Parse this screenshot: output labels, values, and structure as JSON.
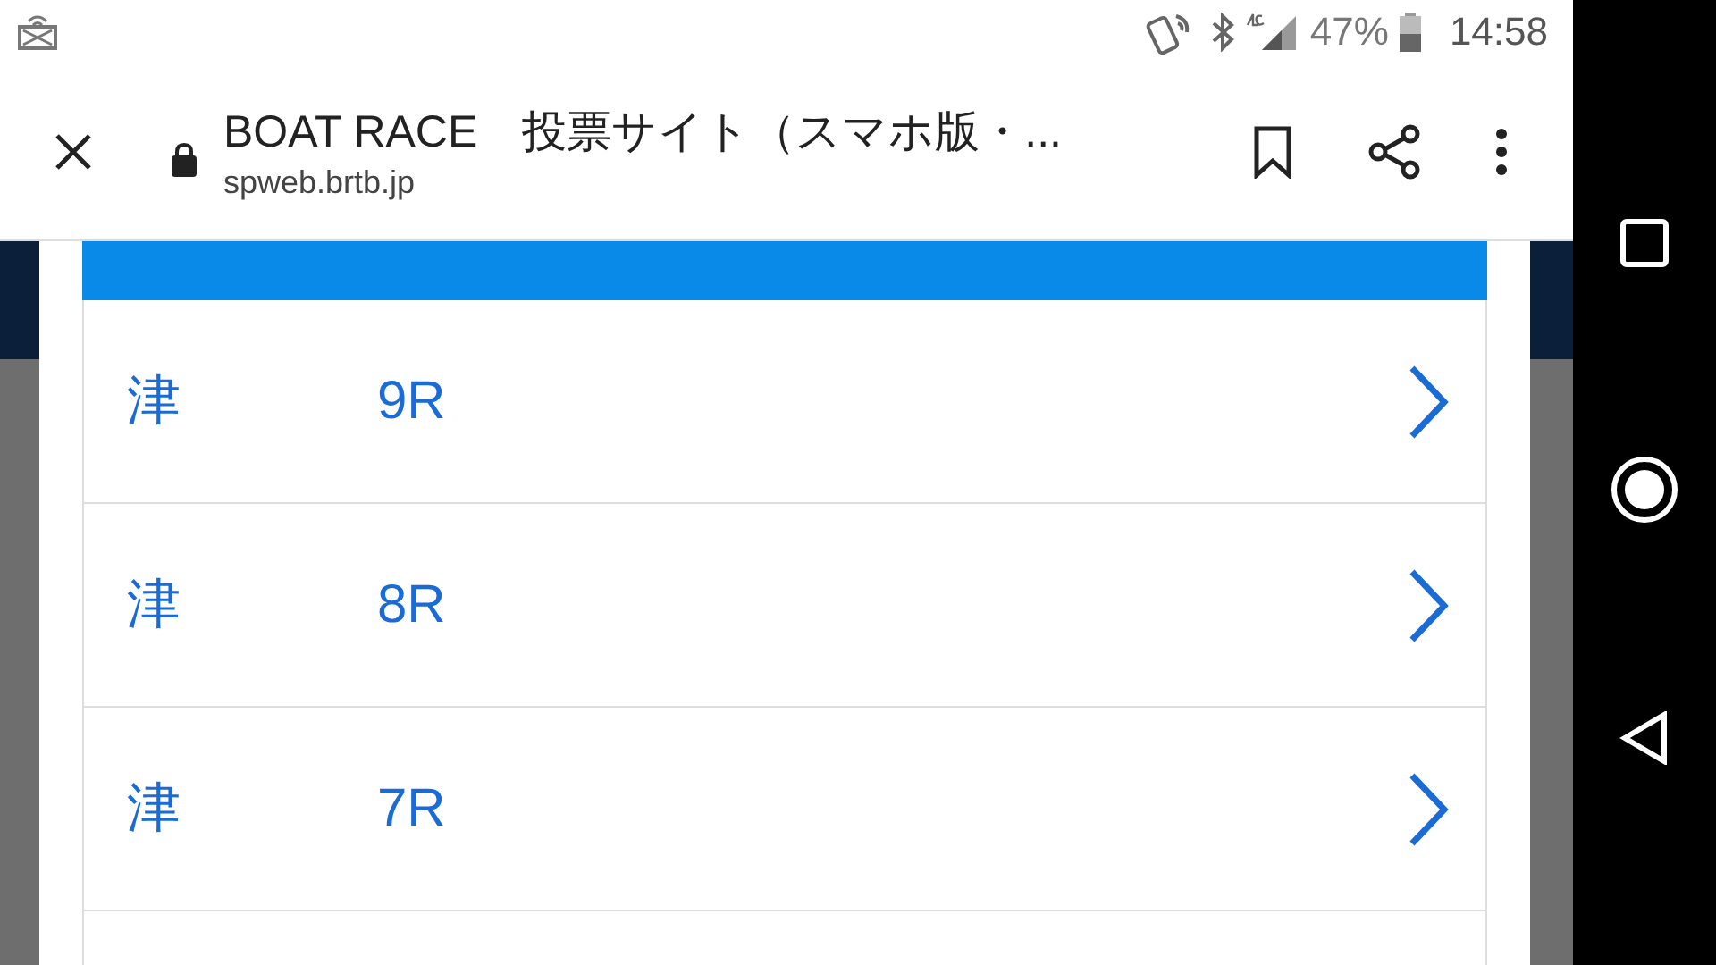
{
  "status_bar": {
    "battery": "47%",
    "time": "14:58"
  },
  "browser_toolbar": {
    "title": "BOAT RACE　投票サイト（スマホ版・...",
    "url": "spweb.brtb.jp"
  },
  "race_list": [
    {
      "venue": "津",
      "race": "9R"
    },
    {
      "venue": "津",
      "race": "8R"
    },
    {
      "venue": "津",
      "race": "7R"
    }
  ]
}
